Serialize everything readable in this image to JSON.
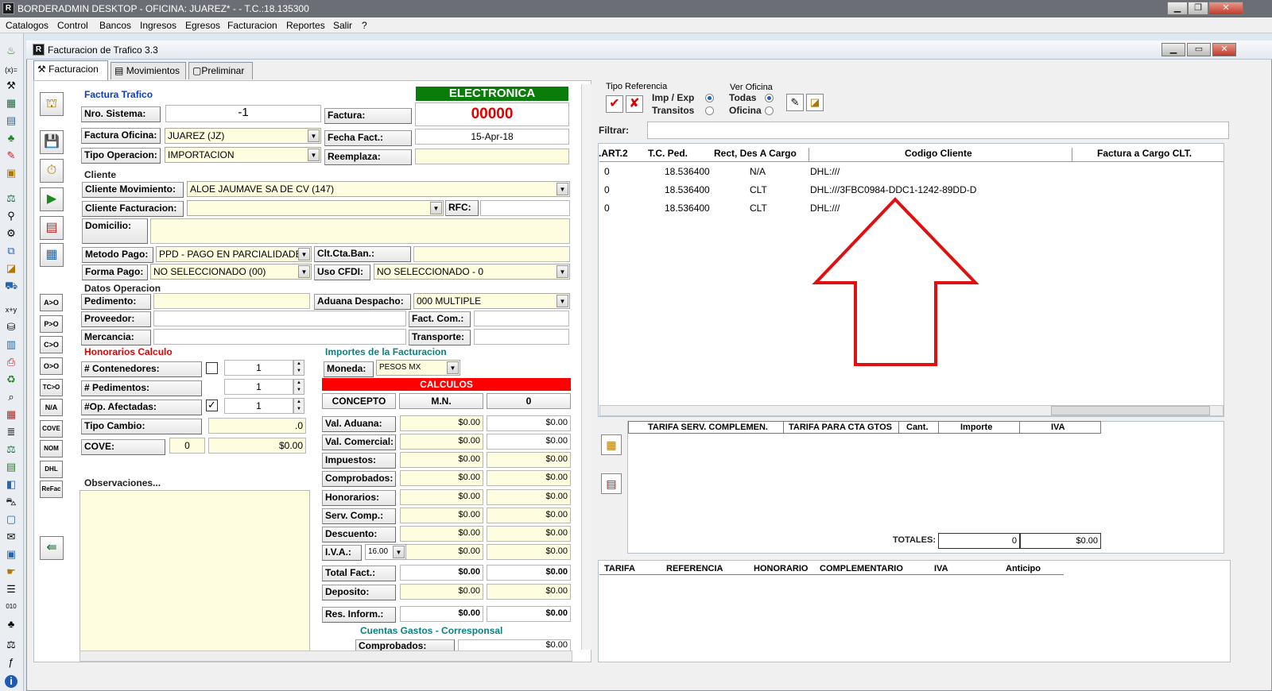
{
  "app": {
    "title": "BORDERADMIN DESKTOP - OFICINA: JUAREZ* -   - T.C.:18.135300",
    "icon": "R"
  },
  "menu": [
    "Catalogos",
    "Control",
    "Bancos",
    "Ingresos",
    "Egresos",
    "Facturacion",
    "Reportes",
    "Salir",
    "?"
  ],
  "window": {
    "title": "Facturacion de Trafico 3.3",
    "tabs": [
      "Facturacion",
      "Movimientos",
      "Preliminar"
    ]
  },
  "factura": {
    "section": "Factura Trafico",
    "status": "ELECTRONICA",
    "nro_sistema_label": "Nro. Sistema:",
    "nro_sistema": "-1",
    "factura_label": "Factura:",
    "factura": "00000",
    "factura_oficina_label": "Factura Oficina:",
    "factura_oficina": "JUAREZ (JZ)",
    "fecha_label": "Fecha Fact.:",
    "fecha": "15-Apr-18",
    "tipo_operacion_label": "Tipo Operacion:",
    "tipo_operacion": "IMPORTACION",
    "reemplaza_label": "Reemplaza:"
  },
  "cliente": {
    "section": "Cliente",
    "movimiento_label": "Cliente Movimiento:",
    "movimiento": "ALOE JAUMAVE SA DE CV (147)",
    "facturacion_label": "Cliente Facturacion:",
    "facturacion": "",
    "rfc_label": "RFC:",
    "domicilio_label": "Domicilio:",
    "metodo_pago_label": "Metodo Pago:",
    "metodo_pago": "PPD - PAGO EN PARCIALIDADES",
    "clt_cta_label": "Clt.Cta.Ban.:",
    "forma_pago_label": "Forma Pago:",
    "forma_pago": "NO SELECCIONADO (00)",
    "uso_cfdi_label": "Uso CFDI:",
    "uso_cfdi": "NO SELECCIONADO - 0"
  },
  "operacion": {
    "section": "Datos Operacion",
    "pedimento_label": "Pedimento:",
    "aduana_label": "Aduana Despacho:",
    "aduana": "000 MULTIPLE",
    "proveedor_label": "Proveedor:",
    "fact_com_label": "Fact. Com.:",
    "mercancia_label": "Mercancia:",
    "transporte_label": "Transporte:"
  },
  "honorarios": {
    "section": "Honorarios Calculo",
    "contenedores_label": "# Contenedores:",
    "contenedores": "1",
    "pedimentos_label": "# Pedimentos:",
    "pedimentos": "1",
    "op_afectadas_label": "#Op. Afectadas:",
    "op_afectadas": "1",
    "op_afectadas_check": "✓",
    "tipo_cambio_label": "Tipo Cambio:",
    "tipo_cambio": ".0",
    "cove_label": "COVE:",
    "cove_count": "0",
    "cove_amount": "$0.00",
    "observaciones_label": "Observaciones..."
  },
  "importes": {
    "section": "Importes de la Facturacion",
    "moneda_label": "Moneda:",
    "moneda": "PESOS MX",
    "calculos": "CALCULOS",
    "concepto": "CONCEPTO",
    "mn": "M.N.",
    "other": "0",
    "rows": [
      {
        "label": "Val. Aduana:",
        "mn": "$0.00",
        "other": "$0.00"
      },
      {
        "label": "Val. Comercial:",
        "mn": "$0.00",
        "other": "$0.00"
      },
      {
        "label": "Impuestos:",
        "mn": "$0.00",
        "other": "$0.00"
      },
      {
        "label": "Comprobados:",
        "mn": "$0.00",
        "other": "$0.00"
      },
      {
        "label": "Honorarios:",
        "mn": "$0.00",
        "other": "$0.00"
      },
      {
        "label": "Serv. Comp.:",
        "mn": "$0.00",
        "other": "$0.00"
      },
      {
        "label": "Descuento:",
        "mn": "$0.00",
        "other": "$0.00"
      },
      {
        "label": "I.V.A.:",
        "mn": "$0.00",
        "other": "$0.00"
      },
      {
        "label": "Total Fact.:",
        "mn": "$0.00",
        "other": "$0.00"
      },
      {
        "label": "Deposito:",
        "mn": "$0.00",
        "other": "$0.00"
      },
      {
        "label": "Res. Inform.:",
        "mn": "$0.00",
        "other": "$0.00"
      }
    ],
    "iva_rate": "16.00",
    "cuentas": "Cuentas Gastos - Corresponsal",
    "comprobados2_label": "Comprobados:",
    "comprobados2": "$0.00"
  },
  "side_buttons": [
    "A>O",
    "P>O",
    "C>O",
    "O>O",
    "TC>O",
    "N/A",
    "COVE",
    "NOM",
    "DHL",
    "ReFac"
  ],
  "right": {
    "tipo_ref_label": "Tipo Referencia",
    "imp_exp": "Imp / Exp",
    "transitos": "Transitos",
    "ver_oficina_label": "Ver Oficina",
    "todas": "Todas",
    "oficina": "Oficina",
    "filtrar_label": "Filtrar:",
    "grid_headers": [
      "ART.2.",
      "T.C. Ped.",
      "Rect, Des A Cargo",
      "Codigo Cliente",
      "Factura a Cargo CLT."
    ],
    "grid_rows": [
      {
        "art": "0",
        "tc": "18.536400",
        "rect": "N/A",
        "codigo": "DHL:///"
      },
      {
        "art": "0",
        "tc": "18.536400",
        "rect": "CLT",
        "codigo": "DHL:///3FBC0984-DDC1-1242-89DD-D"
      },
      {
        "art": "0",
        "tc": "18.536400",
        "rect": "CLT",
        "codigo": "DHL:///"
      }
    ],
    "tarifa_headers": [
      "TARIFA SERV. COMPLEMEN.",
      "TARIFA PARA CTA GTOS",
      "Cant.",
      "Importe",
      "IVA"
    ],
    "totales_label": "TOTALES:",
    "totales_a": "0",
    "totales_b": "$0.00",
    "bottom_headers": [
      "TARIFA",
      "REFERENCIA",
      "HONORARIO",
      "COMPLEMENTARIO",
      "IVA",
      "Anticipo"
    ]
  },
  "colors": {
    "electronica_bg": "#0a7c0a",
    "calculos_bg": "#ff0000",
    "arrow": "#e01010",
    "field_yellow": "#fefde0"
  }
}
